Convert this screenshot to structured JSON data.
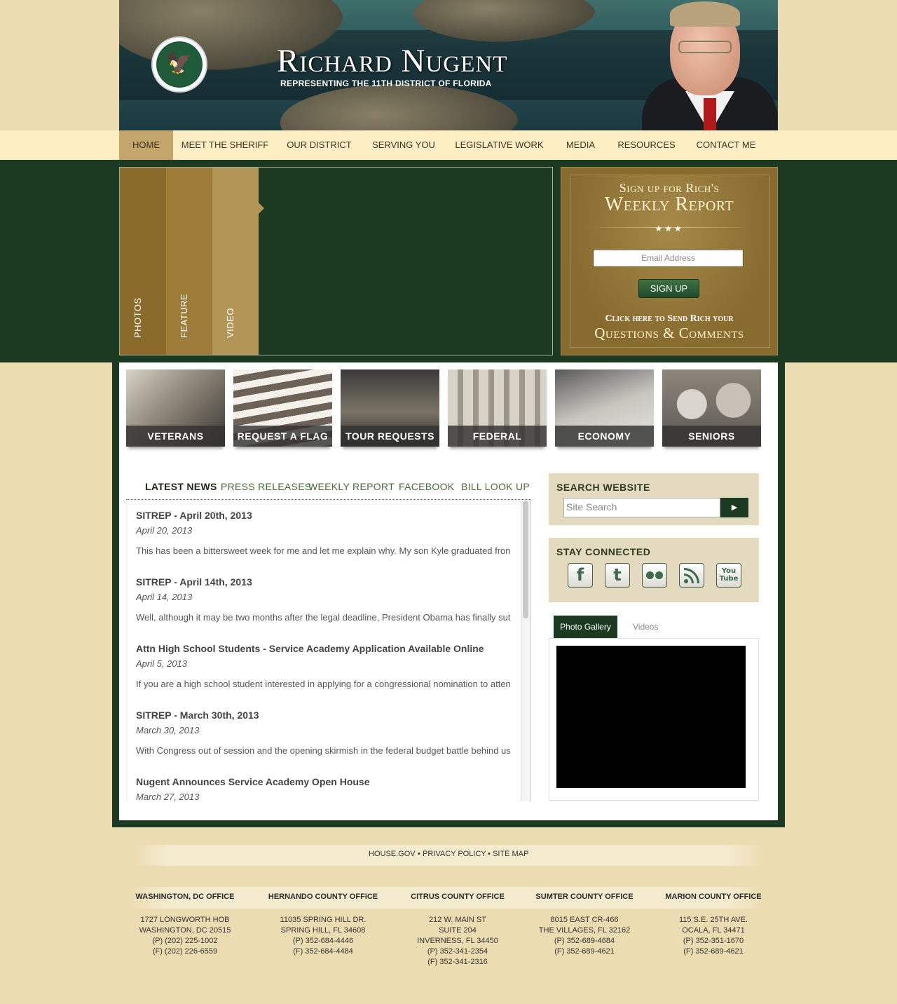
{
  "header": {
    "title": "Richard Nugent",
    "subtitle": "REPRESENTING THE 11TH DISTRICT OF FLORIDA"
  },
  "nav": {
    "items": [
      "HOME",
      "MEET THE SHERIFF",
      "OUR DISTRICT",
      "SERVING YOU",
      "LEGISLATIVE WORK",
      "MEDIA",
      "RESOURCES",
      "CONTACT ME"
    ],
    "active": "HOME"
  },
  "slider": {
    "tabs": [
      "PHOTOS",
      "FEATURE",
      "VIDEO"
    ]
  },
  "signup": {
    "line1": "Sign up for Rich's",
    "line2": "Weekly Report",
    "stars": "★★★",
    "email_placeholder": "Email Address",
    "button": "SIGN UP",
    "questions_line1": "Click here to Send Rich your",
    "questions_line2": "Questions & Comments"
  },
  "tiles": [
    "VETERANS",
    "REQUEST A FLAG",
    "TOUR REQUESTS",
    "FEDERAL AGENCIES",
    "ECONOMY",
    "SENIORS"
  ],
  "news": {
    "tabs": [
      "LATEST NEWS",
      "PRESS RELEASES",
      "WEEKLY REPORT",
      "FACEBOOK",
      "BILL LOOK UP"
    ],
    "active": "LATEST NEWS",
    "items": [
      {
        "title": "SITREP - April 20th, 2013",
        "date": "April 20, 2013",
        "text": "This has been a bittersweet week for me and let me explain why. My son Kyle graduated fron"
      },
      {
        "title": "SITREP - April 14th, 2013",
        "date": "April 14, 2013",
        "text": "Well, although it may be two months after the legal deadline, President Obama has finally sut"
      },
      {
        "title": "Attn High School Students - Service Academy Application Available Online",
        "date": "April 5, 2013",
        "text": "If you are a high school student interested in applying for a congressional nomination to atten"
      },
      {
        "title": "SITREP - March 30th, 2013",
        "date": "March 30, 2013",
        "text": "With Congress out of session and the opening skirmish in the federal budget battle behind us"
      },
      {
        "title": "Nugent Announces Service Academy Open House",
        "date": "March 27, 2013",
        "text": ""
      }
    ]
  },
  "search": {
    "title": "SEARCH WEBSITE",
    "placeholder": "Site Search",
    "button_icon": "play-arrow-icon"
  },
  "connect": {
    "title": "STAY CONNECTED",
    "icons": [
      "facebook-icon",
      "twitter-icon",
      "flickr-icon",
      "rss-icon",
      "youtube-icon"
    ]
  },
  "gallery": {
    "tabs": [
      "Photo Gallery",
      "Videos"
    ],
    "active": "Photo Gallery"
  },
  "footer": {
    "links": [
      "HOUSE.GOV",
      "PRIVACY POLICY",
      "SITE MAP"
    ],
    "separator": "•",
    "offices": [
      {
        "title": "WASHINGTON, DC OFFICE",
        "lines": [
          "1727 LONGWORTH HOB",
          "WASHINGTON, DC 20515",
          "(P) (202) 225-1002",
          "(F) (202) 226-6559"
        ]
      },
      {
        "title": "HERNANDO COUNTY OFFICE",
        "lines": [
          "11035 SPRING HILL DR.",
          "SPRING HILL, FL 34608",
          "(P) 352-684-4446",
          "(F) 352-684-4484"
        ]
      },
      {
        "title": "CITRUS COUNTY OFFICE",
        "lines": [
          "212 W. MAIN ST",
          "SUITE 204",
          "INVERNESS, FL 34450",
          "(P) 352-341-2354",
          "(F) 352-341-2316"
        ]
      },
      {
        "title": "SUMTER COUNTY OFFICE",
        "lines": [
          "8015 EAST CR-466",
          "THE VILLAGES, FL 32162",
          "(P) 352-689-4684",
          "(F) 352-689-4621"
        ]
      },
      {
        "title": "MARION COUNTY OFFICE",
        "lines": [
          "115 S.E. 25TH AVE.",
          "OCALA, FL 34471",
          "(P) 352-351-1670",
          "(F) 352-689-4621"
        ]
      }
    ]
  }
}
